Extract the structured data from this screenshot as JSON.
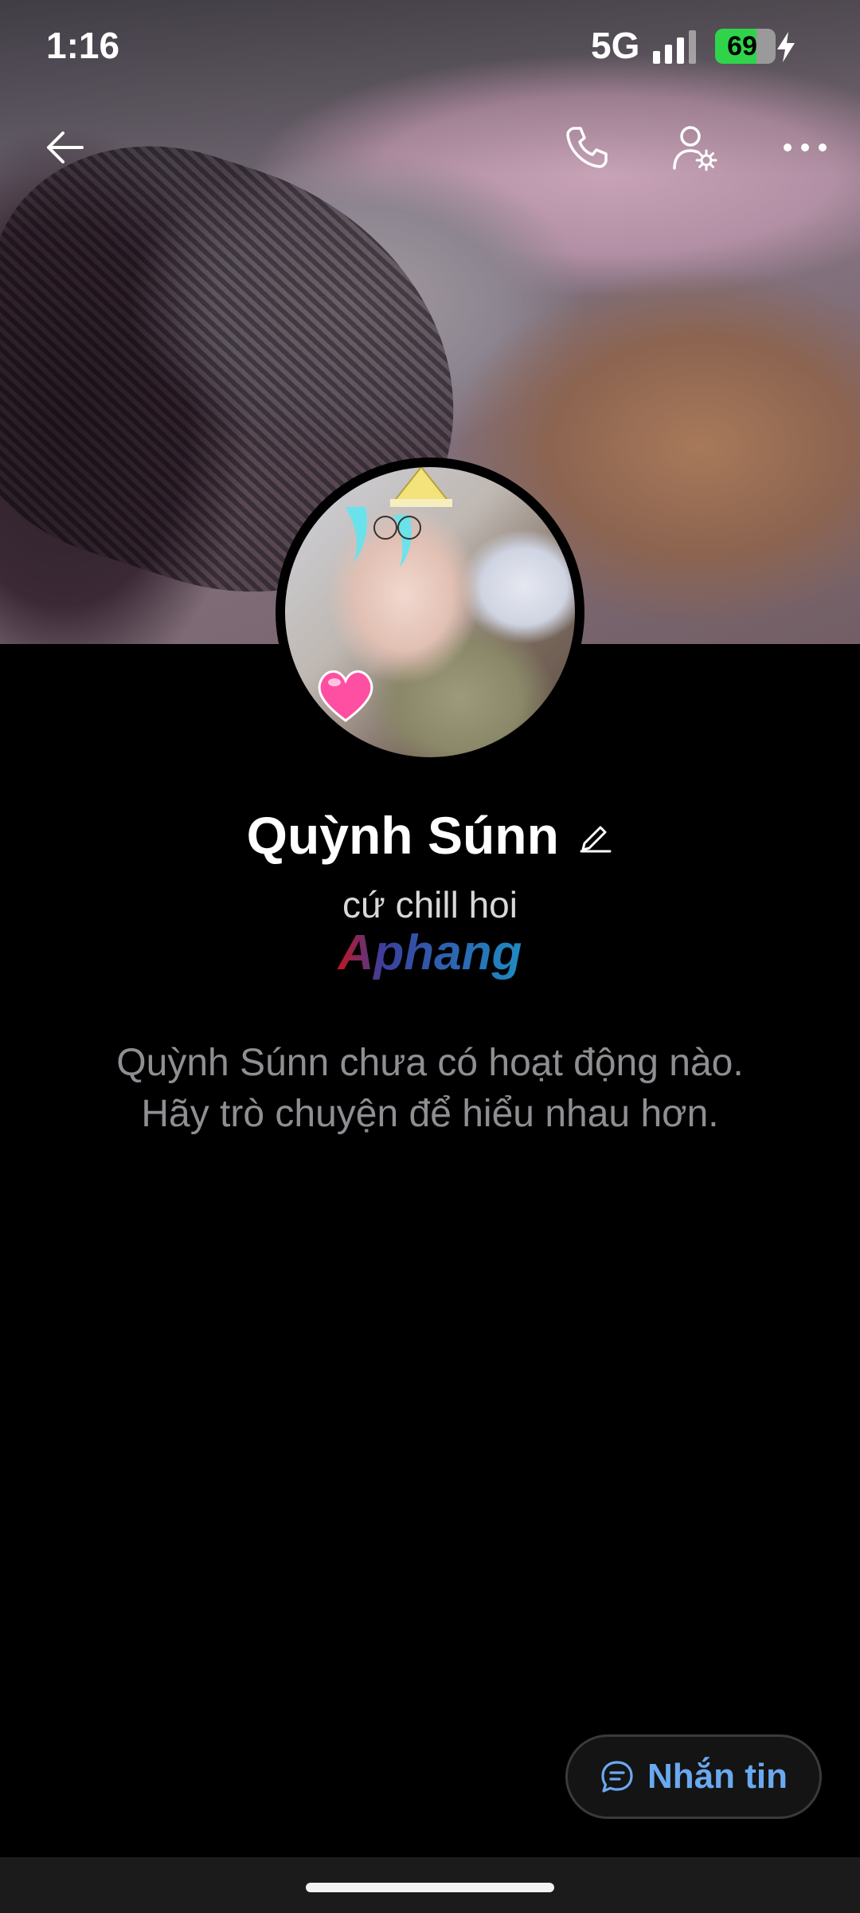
{
  "status_bar": {
    "time": "1:16",
    "network": "5G",
    "battery_percent": "69",
    "battery_level": 0.69,
    "charging": true
  },
  "top_bar": {
    "back_icon": "arrow-left-icon",
    "call_icon": "phone-icon",
    "profile_settings_icon": "user-gear-icon",
    "more_icon": "more-dots-icon"
  },
  "profile": {
    "name": "Quỳnh Súnn",
    "status": "cứ chill hoi",
    "watermark": "Aphang",
    "empty_message_line1": "Quỳnh Súnn chưa có hoạt động nào.",
    "empty_message_line2": "Hãy trò chuyện để hiểu nhau hơn."
  },
  "actions": {
    "message_label": "Nhắn tin",
    "message_icon": "chat-bubble-icon"
  },
  "colors": {
    "accent": "#6aa9f0",
    "battery_green": "#2fd44a",
    "muted_text": "#8e8e93",
    "background": "#000000"
  }
}
